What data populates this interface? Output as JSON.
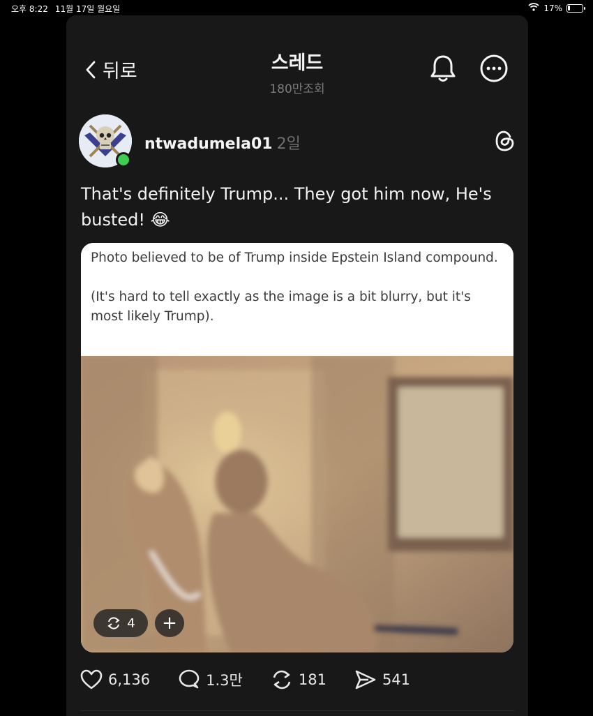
{
  "status_bar": {
    "time": "오후 8:22",
    "date": "11월 17일 월요일",
    "battery_percent": "17%",
    "battery_level": 0.17
  },
  "header": {
    "back_label": "뒤로",
    "title": "스레드",
    "views": "180만조회"
  },
  "post": {
    "username": "ntwadumela01",
    "time_ago": "2일",
    "text": "That's definitely Trump... They got him now, He's busted!",
    "emoji": "😂",
    "media_caption_line1": "Photo believed to be of Trump inside Epstein Island compound.",
    "media_caption_line2": "(It's hard to tell exactly as the image is a bit blurry, but it's most likely Trump).",
    "repost_chip_count": "4",
    "plus_chip": "+"
  },
  "actions": {
    "likes": "6,136",
    "comments": "1.3만",
    "reposts": "181",
    "shares": "541"
  },
  "colors": {
    "panel_bg": "#181818",
    "online": "#3ecf52"
  }
}
